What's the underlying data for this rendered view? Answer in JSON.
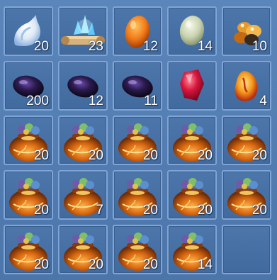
{
  "inventory": {
    "slots": [
      {
        "item": "white-blue-wisp",
        "count": "20"
      },
      {
        "item": "blue-crystal-scroll",
        "count": "23"
      },
      {
        "item": "orange-egg",
        "count": "12"
      },
      {
        "item": "pale-green-egg",
        "count": "14"
      },
      {
        "item": "amber-stones",
        "count": "10"
      },
      {
        "item": "dark-purple-gem",
        "count": "200"
      },
      {
        "item": "dark-purple-gem",
        "count": "12"
      },
      {
        "item": "dark-purple-gem",
        "count": "11"
      },
      {
        "item": "red-gem",
        "count": ""
      },
      {
        "item": "fire-amber-gem",
        "count": "4"
      },
      {
        "item": "treasure-pouch",
        "count": "20"
      },
      {
        "item": "treasure-pouch",
        "count": "20"
      },
      {
        "item": "treasure-pouch",
        "count": "20"
      },
      {
        "item": "treasure-pouch",
        "count": "20"
      },
      {
        "item": "treasure-pouch",
        "count": "20"
      },
      {
        "item": "treasure-pouch",
        "count": "20"
      },
      {
        "item": "treasure-pouch",
        "count": "7"
      },
      {
        "item": "treasure-pouch",
        "count": "20"
      },
      {
        "item": "treasure-pouch",
        "count": "20"
      },
      {
        "item": "treasure-pouch",
        "count": "20"
      },
      {
        "item": "treasure-pouch",
        "count": "20"
      },
      {
        "item": "treasure-pouch",
        "count": "20"
      },
      {
        "item": "treasure-pouch",
        "count": "20"
      },
      {
        "item": "treasure-pouch",
        "count": "14"
      },
      {
        "item": "empty-slot",
        "count": ""
      }
    ]
  }
}
